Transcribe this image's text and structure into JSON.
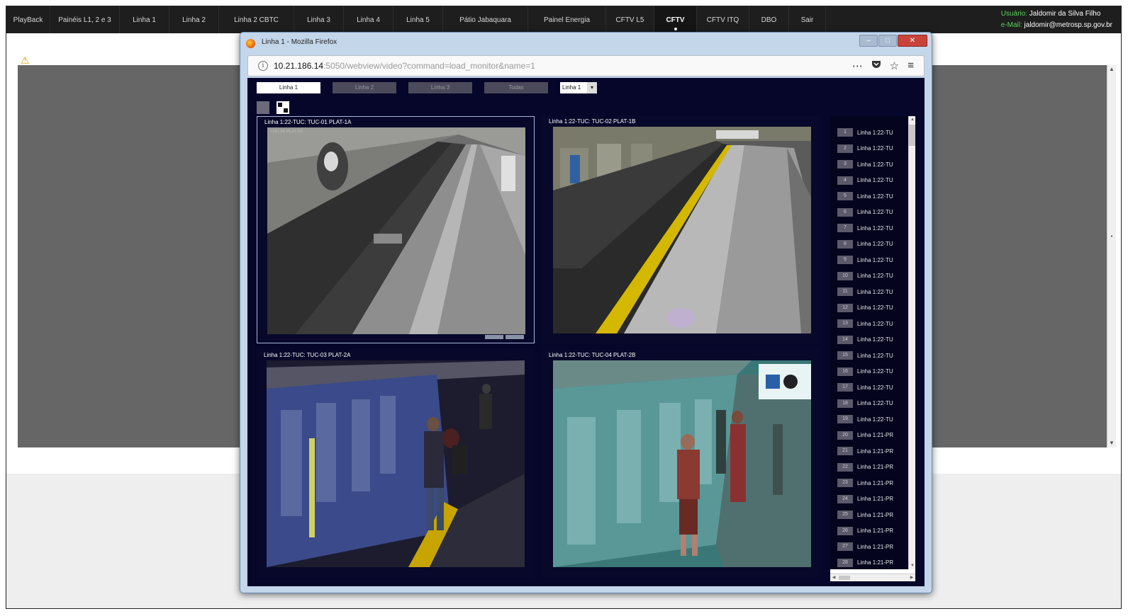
{
  "nav": {
    "items": [
      "PlayBack",
      "Painéis L1, 2 e 3",
      "Linha 1",
      "Linha 2",
      "Linha 2 CBTC",
      "Linha 3",
      "Linha 4",
      "Linha 5",
      "Pátio Jabaquara",
      "Painel Energia",
      "CFTV L5",
      "CFTV",
      "CFTV ITQ",
      "DBO",
      "Sair"
    ],
    "active": "CFTV",
    "user_label": "Usuário:",
    "user_name": "Jaldomir da Silva Filho",
    "email_label": "e-Mail:",
    "email_value": "jaldomir@metrosp.sp.gov.br"
  },
  "browser": {
    "title": "Linha 1 - Mozilla Firefox",
    "url_host": "10.21.186.14",
    "url_path": ":5050/webview/video?command=load_monitor&name=1",
    "actions": [
      "more-actions-icon",
      "pocket-icon",
      "bookmark-star-icon"
    ],
    "menu_icon": "hamburger-menu-icon"
  },
  "page": {
    "tabs": [
      "Linha 1",
      "Linha 2",
      "Linha 3",
      "Todas"
    ],
    "active_tab": "Linha 1",
    "select_value": "Linha 1",
    "layout_buttons": [
      "single-view-icon",
      "quad-view-icon"
    ]
  },
  "cameras": [
    {
      "label": "Linha 1:22-TUC: TUC-01 PLAT-1A",
      "scene": "platform-empty"
    },
    {
      "label": "Linha 1:22-TUC: TUC-02 PLAT-1B",
      "scene": "platform-yellow-line"
    },
    {
      "label": "Linha 1:22-TUC: TUC-03 PLAT-2A",
      "scene": "train-blue-passengers"
    },
    {
      "label": "Linha 1:22-TUC: TUC-04 PLAT-2B",
      "scene": "train-teal-passengers"
    }
  ],
  "camera_list": {
    "items": [
      {
        "num": "1",
        "name": "Linha 1:22-TU"
      },
      {
        "num": "2",
        "name": "Linha 1:22-TU"
      },
      {
        "num": "3",
        "name": "Linha 1:22-TU"
      },
      {
        "num": "4",
        "name": "Linha 1:22-TU"
      },
      {
        "num": "5",
        "name": "Linha 1:22-TU"
      },
      {
        "num": "6",
        "name": "Linha 1:22-TU"
      },
      {
        "num": "7",
        "name": "Linha 1:22-TU"
      },
      {
        "num": "8",
        "name": "Linha 1:22-TU"
      },
      {
        "num": "9",
        "name": "Linha 1:22-TU"
      },
      {
        "num": "10",
        "name": "Linha 1:22-TU"
      },
      {
        "num": "11",
        "name": "Linha 1:22-TU"
      },
      {
        "num": "12",
        "name": "Linha 1:22-TU"
      },
      {
        "num": "13",
        "name": "Linha 1:22-TU"
      },
      {
        "num": "14",
        "name": "Linha 1:22-TU"
      },
      {
        "num": "15",
        "name": "Linha 1:22-TU"
      },
      {
        "num": "16",
        "name": "Linha 1:22-TU"
      },
      {
        "num": "17",
        "name": "Linha 1:22-TU"
      },
      {
        "num": "18",
        "name": "Linha 1:22-TU"
      },
      {
        "num": "19",
        "name": "Linha 1:22-TU"
      },
      {
        "num": "20",
        "name": "Linha 1:21-PR"
      },
      {
        "num": "21",
        "name": "Linha 1:21-PR"
      },
      {
        "num": "22",
        "name": "Linha 1:21-PR"
      },
      {
        "num": "23",
        "name": "Linha 1:21-PR"
      },
      {
        "num": "24",
        "name": "Linha 1:21-PR"
      },
      {
        "num": "25",
        "name": "Linha 1:21-PR"
      },
      {
        "num": "26",
        "name": "Linha 1:21-PR"
      },
      {
        "num": "27",
        "name": "Linha 1:21-PR"
      },
      {
        "num": "28",
        "name": "Linha 1:21-PR"
      }
    ]
  },
  "colors": {
    "nav_bg": "#1e1e1e",
    "user_label": "#5ad15a",
    "content_bg": "#06062a",
    "gray_panel": "#666666"
  }
}
